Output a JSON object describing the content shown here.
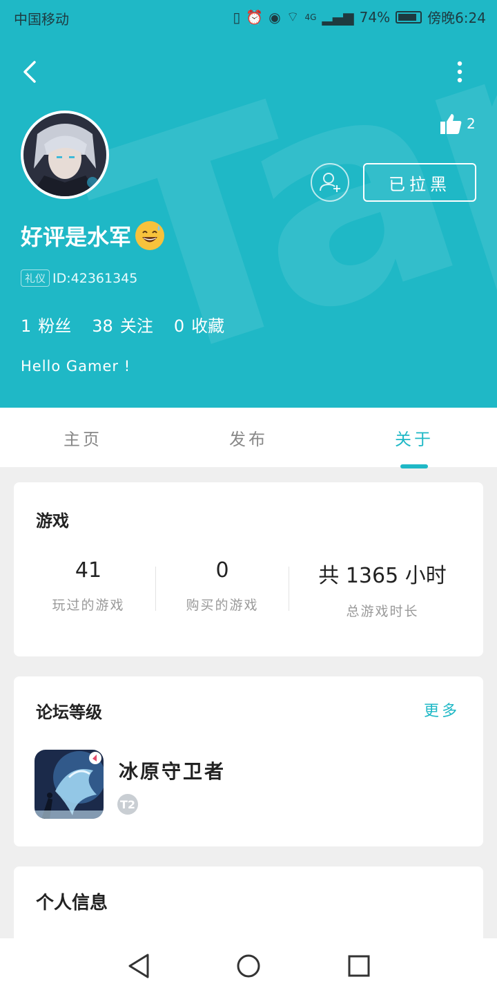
{
  "status_bar": {
    "carrier": "中国移动",
    "battery": "74%",
    "time": "傍晚6:24",
    "net": "4G"
  },
  "header": {
    "like_count": "2",
    "blocked_label": "已拉黑",
    "username": "好评是水军",
    "badge": "礼仪",
    "user_id": "ID:42361345",
    "followers_count": "1",
    "followers_label": "粉丝",
    "following_count": "38",
    "following_label": "关注",
    "favorites_count": "0",
    "favorites_label": "收藏",
    "bio": "Hello Gamer !",
    "colors": {
      "accent": "#1fb8c6"
    }
  },
  "tabs": [
    {
      "label": "主页"
    },
    {
      "label": "发布"
    },
    {
      "label": "关于",
      "active": true
    }
  ],
  "games_card": {
    "title": "游戏",
    "played_value": "41",
    "played_label": "玩过的游戏",
    "bought_value": "0",
    "bought_label": "购买的游戏",
    "hours_value": "共 1365 小时",
    "hours_label": "总游戏时长"
  },
  "forum_card": {
    "title": "论坛等级",
    "more_label": "更多",
    "game_name": "冰原守卫者",
    "level": "T2"
  },
  "personal_card": {
    "title": "个人信息"
  },
  "icons": [
    "back-icon",
    "more-icon",
    "thumbs-up-icon",
    "add-friend-icon",
    "nav-back-icon",
    "nav-home-icon",
    "nav-recent-icon"
  ]
}
